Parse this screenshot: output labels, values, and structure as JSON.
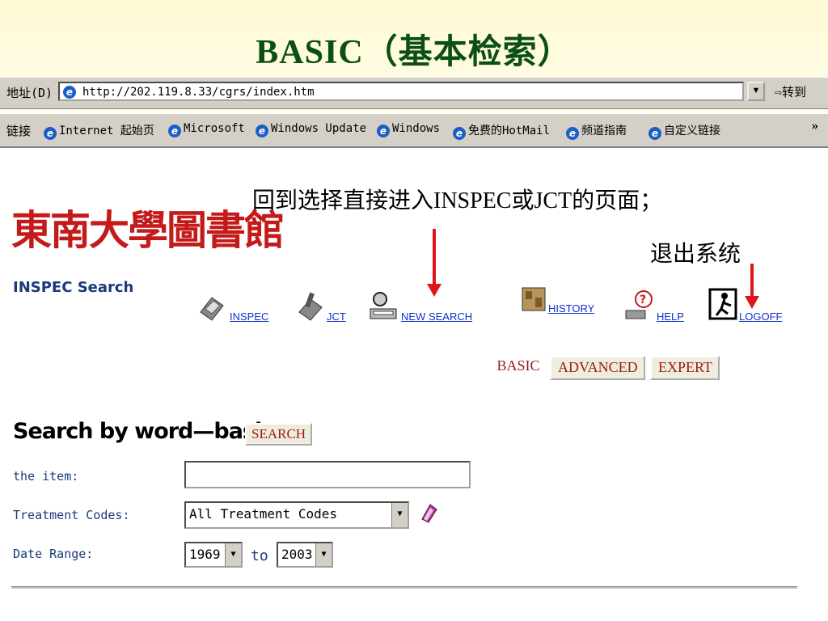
{
  "slide": {
    "title": "BASIC（基本检索）",
    "annotation_1": "回到选择直接进入INSPEC或JCT的页面；",
    "annotation_2": "退出系统",
    "accent_color": "#e0141a",
    "title_color": "#0b4f14"
  },
  "browser": {
    "address_label": "地址(D)",
    "url": "http://202.119.8.33/cgrs/index.htm",
    "go_label": "转到",
    "links_label": "链接",
    "links": [
      "Internet 起始页",
      "Microsoft",
      "Windows Update",
      "Windows",
      "免费的HotMail",
      "频道指南",
      "自定义链接"
    ],
    "more_label": "»"
  },
  "logo": {
    "chinese": "東南大學圖書館",
    "subtitle": "INSPEC Search"
  },
  "nav": {
    "items": [
      {
        "label": "INSPEC",
        "icon": "inspec-icon"
      },
      {
        "label": "JCT",
        "icon": "jct-icon"
      },
      {
        "label": "NEW SEARCH",
        "icon": "new-search-icon"
      },
      {
        "label": "HISTORY",
        "icon": "history-icon"
      },
      {
        "label": "HELP",
        "icon": "help-icon"
      },
      {
        "label": "LOGOFF",
        "icon": "logoff-icon"
      }
    ]
  },
  "modes": {
    "basic": "BASIC",
    "advanced": "ADVANCED",
    "expert": "EXPERT"
  },
  "search": {
    "heading": "Search by word—basic",
    "button": "SEARCH",
    "the_item_label": "the item:",
    "the_item_value": "",
    "treatment_label": "Treatment Codes:",
    "treatment_value": "All Treatment Codes",
    "date_label": "Date Range:",
    "date_from": "1969",
    "to_label": "to",
    "date_to": "2003"
  }
}
